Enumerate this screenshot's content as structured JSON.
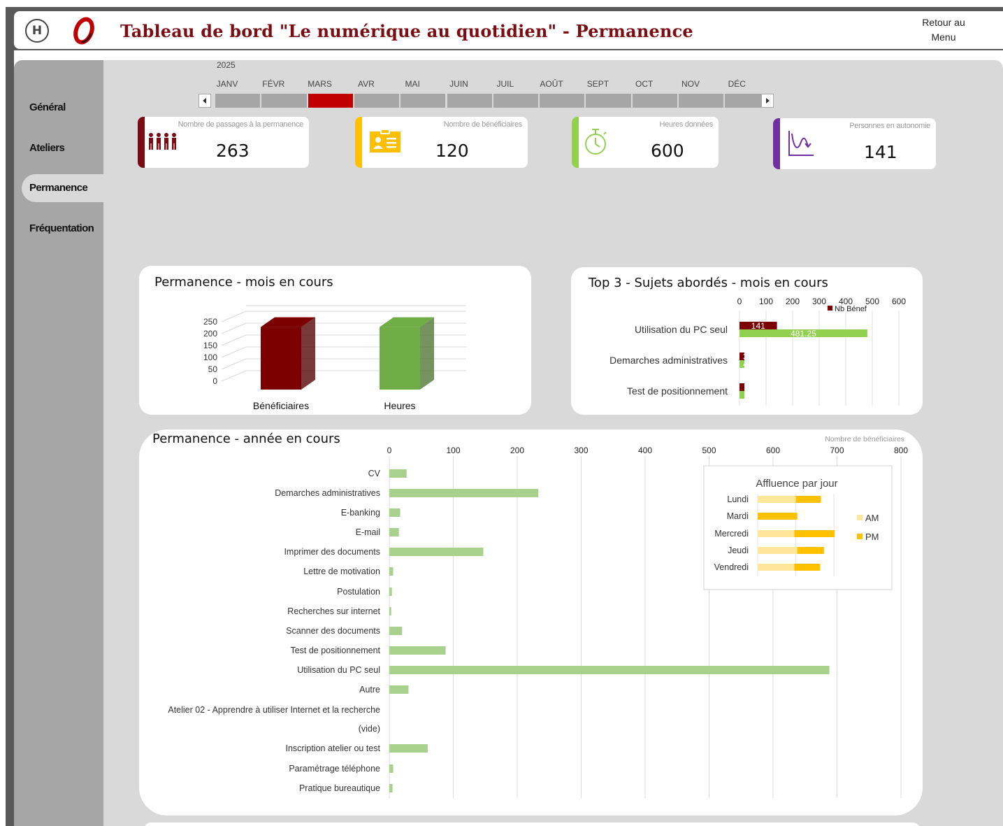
{
  "header": {
    "logo_text": "H",
    "title": "Tableau de bord \"Le numérique au quotidien\" - Permanence",
    "back_label_line1": "Retour au",
    "back_label_line2": "Menu"
  },
  "sidebar": {
    "items": [
      {
        "label": "Général",
        "active": false
      },
      {
        "label": "Ateliers",
        "active": false
      },
      {
        "label": "Permanence",
        "active": true
      },
      {
        "label": "Fréquentation",
        "active": false
      }
    ]
  },
  "timeline": {
    "year": "2025",
    "months": [
      "JANV",
      "FÉVR",
      "MARS",
      "AVR",
      "MAI",
      "JUIN",
      "JUIL",
      "AOÛT",
      "SEPT",
      "OCT",
      "NOV",
      "DÉC"
    ],
    "selected": "MARS"
  },
  "kpis": [
    {
      "label": "Nombre de passages à la permanence",
      "value": "263",
      "color": "#7b0d12",
      "icon": "people-icon"
    },
    {
      "label": "Nombre de bénéficiaires",
      "value": "120",
      "color": "#ffc000",
      "icon": "id-card-icon"
    },
    {
      "label": "Heures données",
      "value": "600",
      "color": "#92d050",
      "icon": "stopwatch-icon"
    },
    {
      "label": "Personnes en autonomie",
      "value": "141",
      "color": "#7030a0",
      "icon": "chart-line-icon"
    }
  ],
  "chart_data": [
    {
      "type": "bar",
      "title": "Permanence - mois en cours",
      "categories": [
        "Bénéficiaires",
        "Heures"
      ],
      "values": [
        263,
        263
      ],
      "colors": [
        "#7b0000",
        "#70ad47"
      ],
      "yticks": [
        "250",
        "200",
        "150",
        "100",
        "50",
        "0"
      ],
      "ylim": [
        0,
        250
      ],
      "grid": true,
      "legend": "none"
    },
    {
      "type": "bar",
      "orientation": "horizontal",
      "title": "Top 3 - Sujets abordés - mois en cours",
      "categories": [
        "Utilisation du PC seul",
        "Demarches administratives",
        "Test de positionnement"
      ],
      "series": [
        {
          "name": "Nb Bénef",
          "values": [
            141,
            3,
            1
          ],
          "color": "#7b0000",
          "labels": [
            "141",
            "3",
            ""
          ]
        },
        {
          "values": [
            481.25,
            4,
            1
          ],
          "color": "#92d050",
          "labels": [
            "481.25",
            "4",
            ""
          ]
        }
      ],
      "xticks": [
        "0",
        "100",
        "200",
        "300",
        "400",
        "500",
        "600"
      ],
      "xlim": [
        0,
        600
      ],
      "legend": "top-right"
    },
    {
      "type": "bar",
      "orientation": "horizontal",
      "title": "Permanence - année en cours",
      "xlabel": "Nombre de bénéficiaires",
      "categories": [
        "CV",
        "Demarches administratives",
        "E-banking",
        "E-mail",
        "Imprimer des documents",
        "Lettre de motivation",
        "Postulation",
        "Recherches sur internet",
        "Scanner des documents",
        "Test de positionnement",
        "Utilisation du PC seul",
        "Autre",
        "Atelier 02 - Apprendre à utiliser Internet et la recherche",
        "(vide)",
        "Inscription atelier ou test",
        "Paramétrage téléphone",
        "Pratique bureautique"
      ],
      "values": [
        27,
        233,
        17,
        15,
        147,
        6,
        4,
        3,
        20,
        88,
        688,
        30,
        0,
        0,
        60,
        6,
        5
      ],
      "color": "#a9d18e",
      "xticks": [
        "0",
        "100",
        "200",
        "300",
        "400",
        "500",
        "600",
        "700",
        "800"
      ],
      "xlim": [
        0,
        800
      ],
      "grid": true
    },
    {
      "type": "bar",
      "orientation": "horizontal",
      "stacked": true,
      "title": "Affluence par jour",
      "categories": [
        "Lundi",
        "Mardi",
        "Mercredi",
        "Jeudi",
        "Vendredi"
      ],
      "series": [
        {
          "name": "AM",
          "values": [
            50,
            0,
            48,
            52,
            48
          ],
          "color": "#ffe699"
        },
        {
          "name": "PM",
          "values": [
            33,
            52,
            53,
            35,
            34
          ],
          "color": "#ffc000"
        }
      ],
      "xlim": [
        0,
        110
      ],
      "legend": "right"
    }
  ]
}
